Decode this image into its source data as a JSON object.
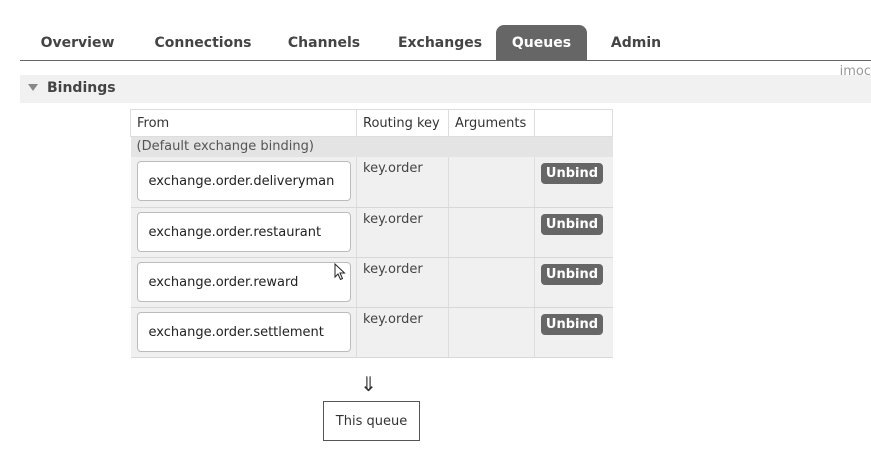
{
  "nav": {
    "tabs": [
      {
        "label": "Overview"
      },
      {
        "label": "Connections"
      },
      {
        "label": "Channels"
      },
      {
        "label": "Exchanges"
      },
      {
        "label": "Queues"
      },
      {
        "label": "Admin"
      }
    ],
    "active_tab": "Queues"
  },
  "user_label": "imoc",
  "section": {
    "title": "Bindings",
    "icon": "triangle-down-icon"
  },
  "bindings_table": {
    "headers": {
      "from": "From",
      "routing_key": "Routing key",
      "arguments": "Arguments"
    },
    "default_binding": "(Default exchange binding)",
    "rows": [
      {
        "exchange": "exchange.order.deliveryman",
        "routing_key": "key.order",
        "arguments": "",
        "action": "Unbind"
      },
      {
        "exchange": "exchange.order.restaurant",
        "routing_key": "key.order",
        "arguments": "",
        "action": "Unbind"
      },
      {
        "exchange": "exchange.order.reward",
        "routing_key": "key.order",
        "arguments": "",
        "action": "Unbind"
      },
      {
        "exchange": "exchange.order.settlement",
        "routing_key": "key.order",
        "arguments": "",
        "action": "Unbind"
      }
    ]
  },
  "flow": {
    "arrow": "⇓",
    "target_label": "This queue"
  },
  "colors": {
    "active_tab_bg": "#666666",
    "button_bg": "#666666",
    "row_bg": "#f0f0f0"
  }
}
